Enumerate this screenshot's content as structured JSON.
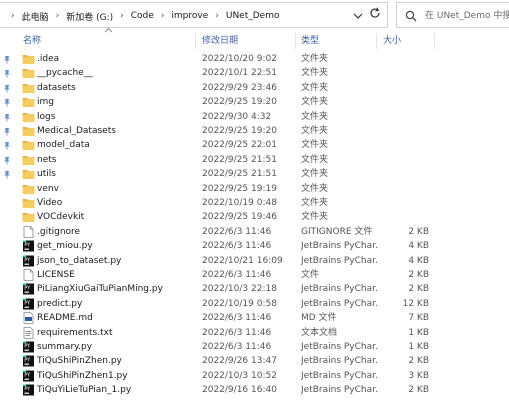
{
  "address": {
    "crumbs": [
      "此电脑",
      "新加卷 (G:)",
      "Code",
      "improve",
      "UNet_Demo"
    ]
  },
  "search": {
    "placeholder": "在 UNet_Demo 中搜索"
  },
  "columns": {
    "name": "名称",
    "date": "修改日期",
    "type": "类型",
    "size": "大小"
  },
  "rows": [
    {
      "name": ".idea",
      "date": "2022/10/20 9:02",
      "type": "文件夹",
      "size": "",
      "icon": "folder-icon",
      "pinned": true
    },
    {
      "name": "__pycache__",
      "date": "2022/10/1 22:51",
      "type": "文件夹",
      "size": "",
      "icon": "folder-icon",
      "pinned": true
    },
    {
      "name": "datasets",
      "date": "2022/9/29 23:46",
      "type": "文件夹",
      "size": "",
      "icon": "folder-icon",
      "pinned": true
    },
    {
      "name": "img",
      "date": "2022/9/25 19:20",
      "type": "文件夹",
      "size": "",
      "icon": "folder-icon",
      "pinned": true
    },
    {
      "name": "logs",
      "date": "2022/9/30 4:32",
      "type": "文件夹",
      "size": "",
      "icon": "folder-icon",
      "pinned": true
    },
    {
      "name": "Medical_Datasets",
      "date": "2022/9/25 19:20",
      "type": "文件夹",
      "size": "",
      "icon": "folder-icon",
      "pinned": true
    },
    {
      "name": "model_data",
      "date": "2022/9/25 22:01",
      "type": "文件夹",
      "size": "",
      "icon": "folder-icon",
      "pinned": true
    },
    {
      "name": "nets",
      "date": "2022/9/25 21:51",
      "type": "文件夹",
      "size": "",
      "icon": "folder-icon",
      "pinned": true
    },
    {
      "name": "utils",
      "date": "2022/9/25 21:51",
      "type": "文件夹",
      "size": "",
      "icon": "folder-icon",
      "pinned": true
    },
    {
      "name": "venv",
      "date": "2022/9/25 19:19",
      "type": "文件夹",
      "size": "",
      "icon": "folder-icon",
      "pinned": false
    },
    {
      "name": "Video",
      "date": "2022/10/19 0:48",
      "type": "文件夹",
      "size": "",
      "icon": "folder-icon",
      "pinned": false
    },
    {
      "name": "VOCdevkit",
      "date": "2022/9/25 19:46",
      "type": "文件夹",
      "size": "",
      "icon": "folder-icon",
      "pinned": false
    },
    {
      "name": ".gitignore",
      "date": "2022/6/3 11:46",
      "type": "GITIGNORE 文件",
      "size": "2 KB",
      "icon": "file-icon",
      "pinned": false
    },
    {
      "name": "get_miou.py",
      "date": "2022/6/3 11:46",
      "type": "JetBrains PyChar...",
      "size": "4 KB",
      "icon": "pycharm-file-icon",
      "pinned": false
    },
    {
      "name": "json_to_dataset.py",
      "date": "2022/10/21 16:09",
      "type": "JetBrains PyChar...",
      "size": "4 KB",
      "icon": "pycharm-file-icon",
      "pinned": false
    },
    {
      "name": "LICENSE",
      "date": "2022/6/3 11:46",
      "type": "文件",
      "size": "2 KB",
      "icon": "file-icon",
      "pinned": false
    },
    {
      "name": "PiLiangXiuGaiTuPianMing.py",
      "date": "2022/10/3 22:18",
      "type": "JetBrains PyChar...",
      "size": "2 KB",
      "icon": "pycharm-file-icon",
      "pinned": false
    },
    {
      "name": "predict.py",
      "date": "2022/10/19 0:58",
      "type": "JetBrains PyChar...",
      "size": "12 KB",
      "icon": "pycharm-file-icon",
      "pinned": false
    },
    {
      "name": "README.md",
      "date": "2022/6/3 11:46",
      "type": "MD 文件",
      "size": "7 KB",
      "icon": "markdown-file-icon",
      "pinned": false
    },
    {
      "name": "requirements.txt",
      "date": "2022/6/3 11:46",
      "type": "文本文档",
      "size": "1 KB",
      "icon": "text-file-icon",
      "pinned": false
    },
    {
      "name": "summary.py",
      "date": "2022/6/3 11:46",
      "type": "JetBrains PyChar...",
      "size": "1 KB",
      "icon": "pycharm-file-icon",
      "pinned": false
    },
    {
      "name": "TiQuShiPinZhen.py",
      "date": "2022/9/26 13:47",
      "type": "JetBrains PyChar...",
      "size": "2 KB",
      "icon": "pycharm-file-icon",
      "pinned": false
    },
    {
      "name": "TiQuShiPinZhen1.py",
      "date": "2022/10/3 10:52",
      "type": "JetBrains PyChar...",
      "size": "3 KB",
      "icon": "pycharm-file-icon",
      "pinned": false
    },
    {
      "name": "TiQuYiLieTuPian_1.py",
      "date": "2022/9/16 16:40",
      "type": "JetBrains PyChar...",
      "size": "2 KB",
      "icon": "pycharm-file-icon",
      "pinned": false
    }
  ],
  "colors": {
    "folder": "#e8b54a",
    "header_text": "#3b5ea8",
    "pin": "#6b8fd6"
  }
}
